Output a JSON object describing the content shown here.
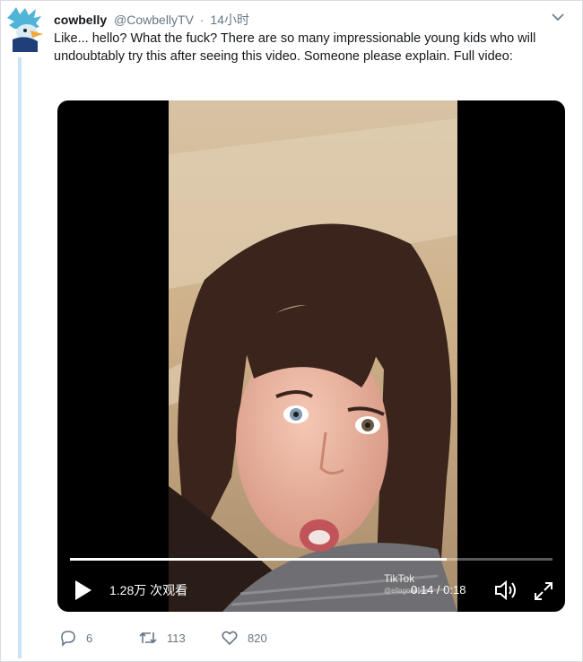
{
  "tweet": {
    "display_name": "cowbelly",
    "handle": "@CowbellyTV",
    "separator": "·",
    "timestamp": "14小时",
    "text": "Like... hello? What the fuck? There are so many impressionable young kids who will undoubtably try this after seeing this video. Someone please explain. Full video:"
  },
  "video": {
    "views": "1.28万 次观看",
    "time": "0:14 / 0:18",
    "progress": 0.78,
    "watermark": "TikTok",
    "watermark_handle": "@ellagonlives"
  },
  "actions": {
    "replies": "6",
    "retweets": "113",
    "likes": "820"
  },
  "colors": {
    "thread_line": "#c9e4f7",
    "text": "#14171a",
    "secondary": "#657786"
  },
  "icons": [
    "avatar-bird",
    "chevron-down-icon",
    "play-icon",
    "volume-icon",
    "fullscreen-icon",
    "reply-icon",
    "retweet-icon",
    "like-icon"
  ]
}
